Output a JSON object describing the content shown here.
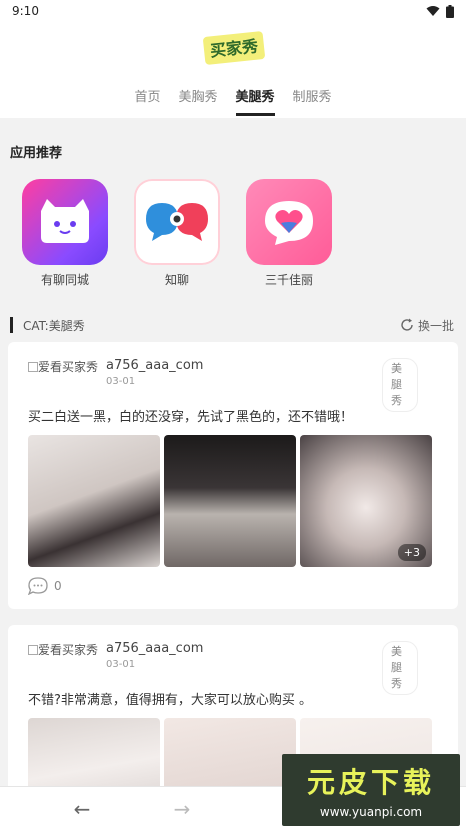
{
  "status": {
    "time": "9:10"
  },
  "header": {
    "logo_text": "买家秀",
    "tabs": [
      {
        "label": "首页",
        "active": false
      },
      {
        "label": "美胸秀",
        "active": false
      },
      {
        "label": "美腿秀",
        "active": true
      },
      {
        "label": "制服秀",
        "active": false
      }
    ]
  },
  "apps": {
    "title": "应用推荐",
    "items": [
      {
        "label": "有聊同城"
      },
      {
        "label": "知聊"
      },
      {
        "label": "三千佳丽"
      }
    ]
  },
  "section": {
    "title": "CAT:美腿秀",
    "refresh_label": "换一批"
  },
  "posts": [
    {
      "avatar_alt": "爱看买家秀",
      "username": "a756_aaa_com",
      "date": "03-01",
      "tag": "美腿秀",
      "content": "买二白送一黑，白的还没穿，先试了黑色的，还不错哦！",
      "more_count": "+3",
      "comments": "0"
    },
    {
      "avatar_alt": "爱看买家秀",
      "username": "a756_aaa_com",
      "date": "03-01",
      "tag": "美腿秀",
      "content": "不错?非常满意，值得拥有，大家可以放心购买 。"
    }
  ],
  "watermark": {
    "title": "元皮下载",
    "url": "www.yuanpi.com"
  },
  "colors": {
    "accent": "#222222",
    "watermark_bg": "#2f3b2f",
    "watermark_title": "#e7f25a"
  }
}
